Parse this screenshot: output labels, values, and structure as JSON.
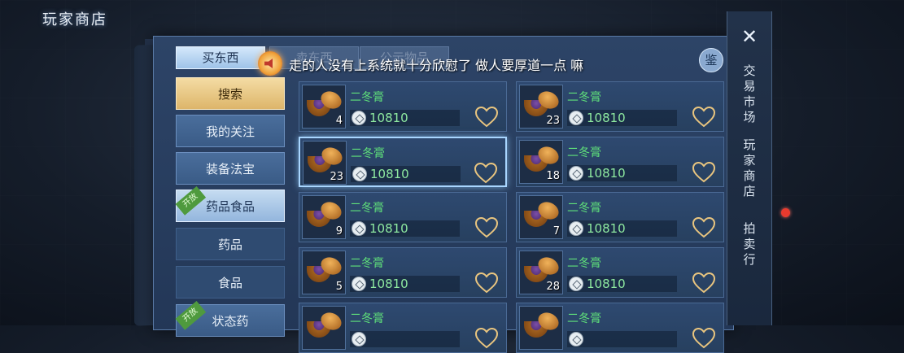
{
  "title": "玩家商店",
  "tabs": [
    "买东西",
    "卖东西",
    "公示物品"
  ],
  "marquee": "走的人没有上系统就十分欣慰了 做人要厚道一点 嘛",
  "appraise_label": "鉴",
  "categories": [
    {
      "label": "搜索",
      "state": "active"
    },
    {
      "label": "我的关注",
      "state": "normal"
    },
    {
      "label": "装备法宝",
      "state": "normal"
    },
    {
      "label": "药品食品",
      "state": "selected",
      "badge": "开放"
    },
    {
      "label": "药品",
      "state": "sub"
    },
    {
      "label": "食品",
      "state": "sub"
    },
    {
      "label": "状态药",
      "state": "normal",
      "badge": "开放"
    }
  ],
  "items": [
    {
      "name": "二冬膏",
      "qty": "4",
      "price": "10810"
    },
    {
      "name": "二冬膏",
      "qty": "23",
      "price": "10810"
    },
    {
      "name": "二冬膏",
      "qty": "23",
      "price": "10810",
      "selected": true
    },
    {
      "name": "二冬膏",
      "qty": "18",
      "price": "10810"
    },
    {
      "name": "二冬膏",
      "qty": "9",
      "price": "10810"
    },
    {
      "name": "二冬膏",
      "qty": "7",
      "price": "10810"
    },
    {
      "name": "二冬膏",
      "qty": "5",
      "price": "10810"
    },
    {
      "name": "二冬膏",
      "qty": "28",
      "price": "10810"
    },
    {
      "name": "二冬膏",
      "qty": "",
      "price": ""
    },
    {
      "name": "二冬膏",
      "qty": "",
      "price": ""
    }
  ],
  "side_menu": [
    "交易市场",
    "玩家商店",
    "拍卖行"
  ],
  "colors": {
    "item_name": "#5fe07a",
    "price": "#8ee9a0",
    "active_tab": "#b9d8f5",
    "search_button": "#e7c67f"
  }
}
